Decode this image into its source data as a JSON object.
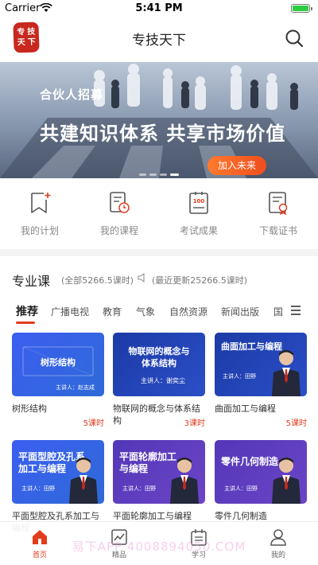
{
  "status_bar": {
    "carrier": "Carrier",
    "time": "5:41 PM",
    "battery_level": 1.0
  },
  "nav": {
    "logo_chars": [
      "专",
      "技",
      "天",
      "下"
    ],
    "title": "专技天下"
  },
  "banner": {
    "eyebrow": "合伙人招募",
    "headline": "共建知识体系  共享市场价值",
    "cta": "加入未来",
    "page_count": 4,
    "active_page": 4
  },
  "quick_links": [
    {
      "label": "我的计划",
      "icon": "bookmark-plus-icon"
    },
    {
      "label": "我的课程",
      "icon": "course-clock-icon"
    },
    {
      "label": "考试成果",
      "icon": "exam-score-icon"
    },
    {
      "label": "下载证书",
      "icon": "certificate-icon"
    }
  ],
  "section": {
    "title": "专业课",
    "total": "(全部5266.5课时)",
    "updated": "(最近更新25266.5课时)"
  },
  "tabs": [
    "推荐",
    "广播电视",
    "教育",
    "气象",
    "自然资源",
    "新闻出版",
    "国"
  ],
  "active_tab": 0,
  "courses": [
    {
      "thumb_title": "树形结构",
      "lecturer": "主讲人：赵志成",
      "title": "树形结构",
      "hours": "5课时",
      "theme": "blue",
      "has_person": false
    },
    {
      "thumb_title": "物联网的概念与体系结构",
      "thumb_line1": "物联网的概念与",
      "thumb_line2": "体系结构",
      "lecturer": "主讲人：谢奕尘",
      "title": "物联网的概念与体系结构",
      "hours": "3课时",
      "theme": "navy",
      "has_person": false
    },
    {
      "thumb_title": "曲面加工与编程",
      "lecturer": "主讲人：田野",
      "title": "曲面加工与编程",
      "hours": "5课时",
      "theme": "navy",
      "has_person": true
    },
    {
      "thumb_title": "平面型腔及孔系加工与编程",
      "thumb_line1": "平面型腔及孔系",
      "thumb_line2": "加工与编程",
      "lecturer": "主讲人：田野",
      "title": "平面型腔及孔系加工与编程",
      "hours": "",
      "theme": "blue",
      "has_person": true
    },
    {
      "thumb_title": "平面轮廓加工与编程",
      "thumb_line1": "平面轮廓加工",
      "thumb_line2": "与编程",
      "lecturer": "主讲人：田野",
      "title": "平面轮廓加工与编程",
      "hours": "",
      "theme": "purple",
      "has_person": true
    },
    {
      "thumb_title": "零件几何制造",
      "lecturer": "主讲人：田野",
      "title": "零件几何制造",
      "hours": "",
      "theme": "purple",
      "has_person": true
    }
  ],
  "watermark": "易下APP  4008894050.COM",
  "tab_bar": [
    {
      "label": "首页",
      "icon": "home-icon"
    },
    {
      "label": "精品",
      "icon": "chart-icon"
    },
    {
      "label": "学习",
      "icon": "calendar-icon"
    },
    {
      "label": "我的",
      "icon": "user-icon"
    }
  ],
  "active_tab_bar": 0,
  "colors": {
    "accent": "#e23c1e",
    "icon_gray": "#666666"
  }
}
